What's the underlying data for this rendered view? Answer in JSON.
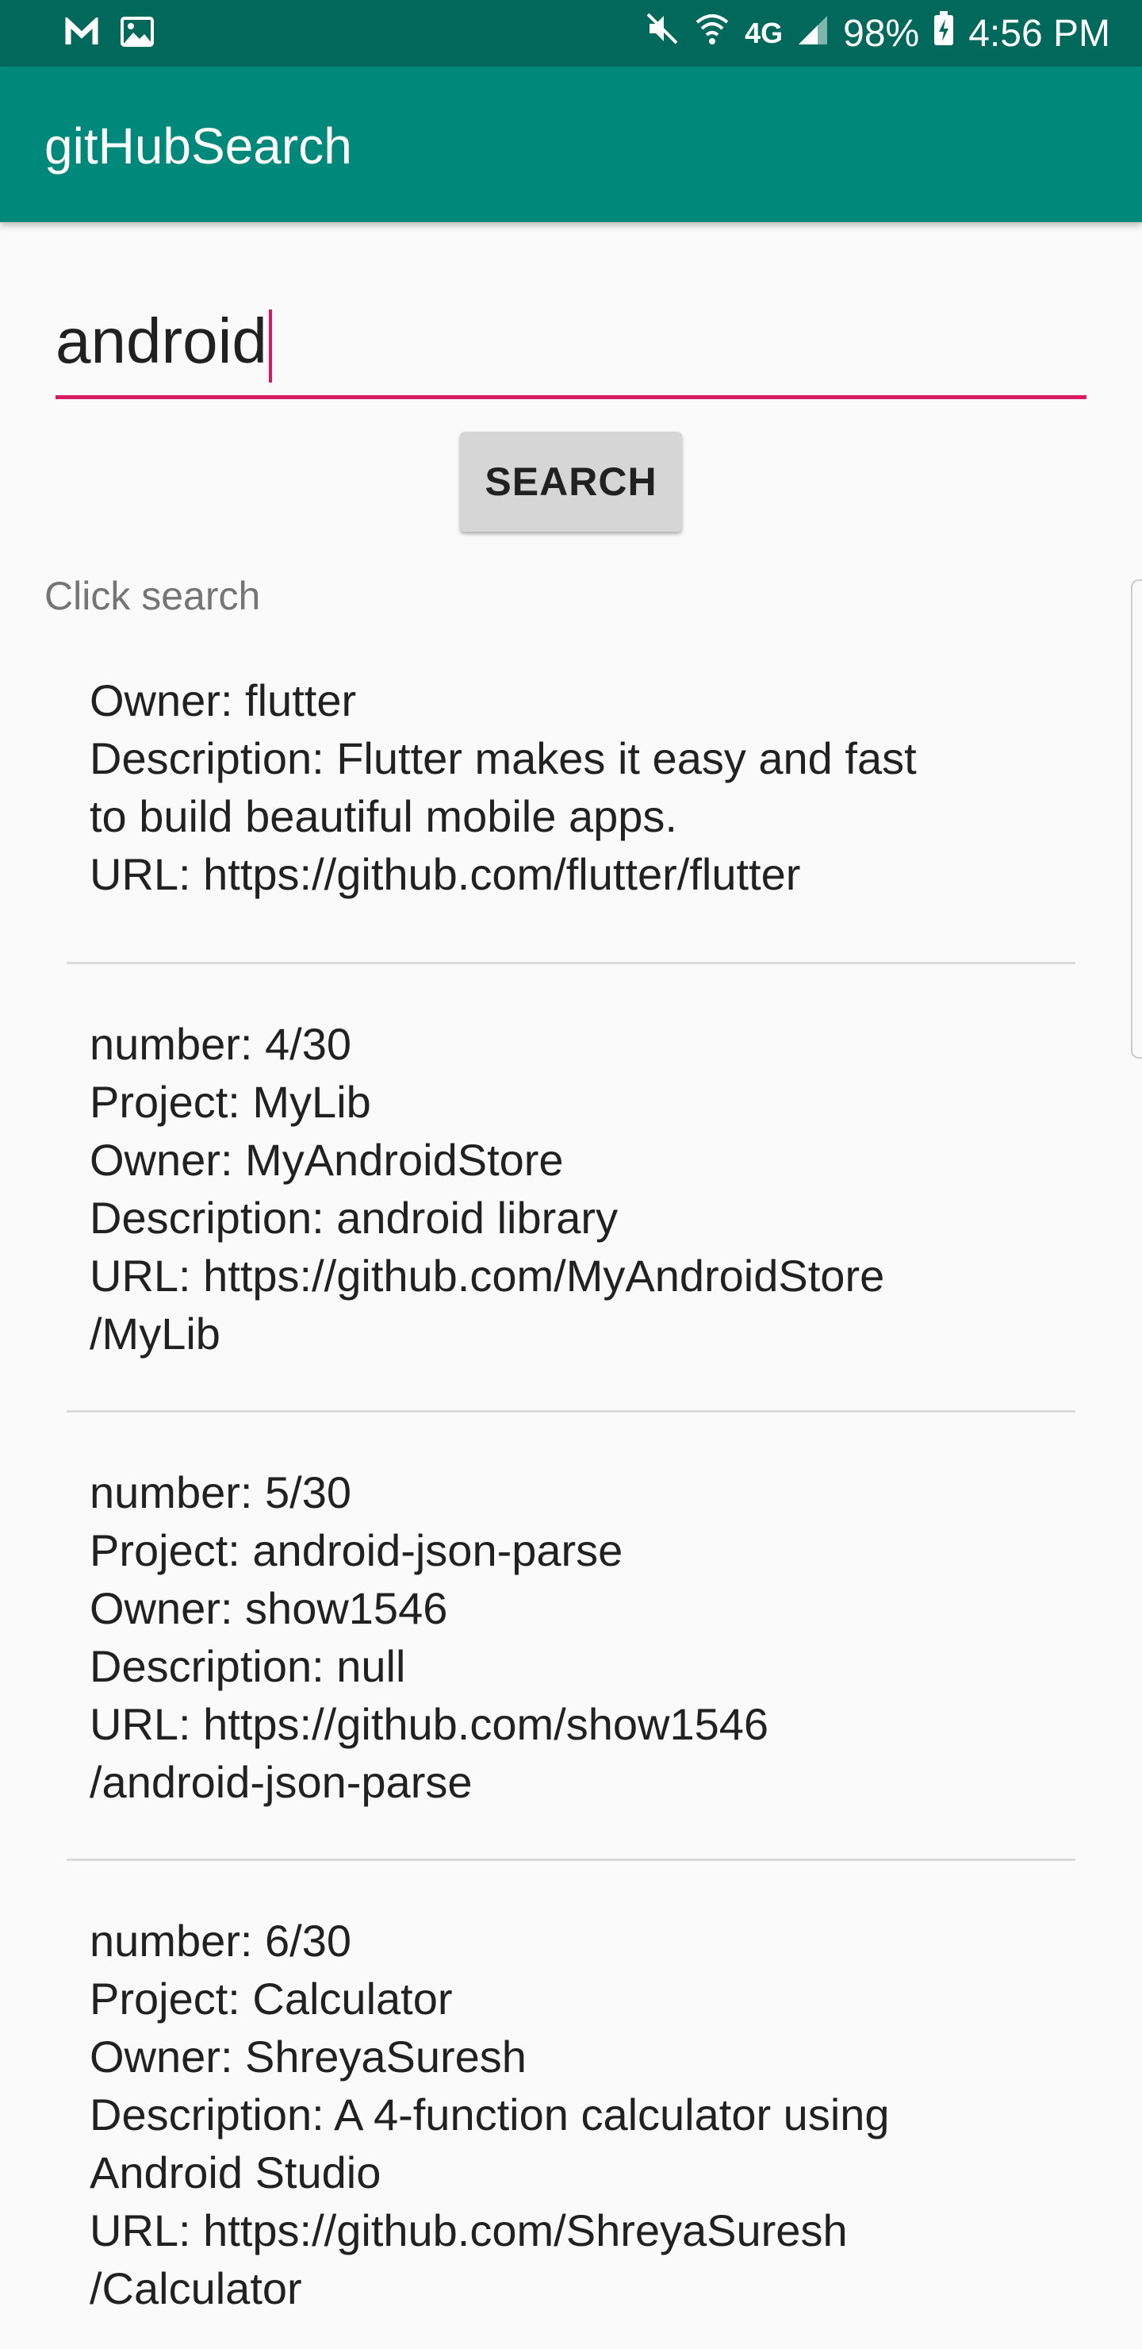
{
  "status_bar": {
    "battery": "98%",
    "time": "4:56 PM",
    "network": "4G",
    "icons": [
      "app-m-icon",
      "image-icon",
      "mute-icon",
      "wifi-icon",
      "signal-icon",
      "battery-charging-icon"
    ]
  },
  "app_bar": {
    "title": "gitHubSearch"
  },
  "search": {
    "value": "android",
    "button_label": "SEARCH"
  },
  "status_text": "Click search",
  "results": [
    {
      "number": "",
      "text": "Owner: flutter\nDescription: Flutter makes it easy and fast\nto build beautiful mobile apps.\nURL: https://github.com/flutter/flutter"
    },
    {
      "text": "number: 4/30\nProject: MyLib\nOwner: MyAndroidStore\nDescription: android library\nURL: https://github.com/MyAndroidStore\n/MyLib"
    },
    {
      "text": "number: 5/30\nProject: android-json-parse\nOwner: show1546\nDescription: null\nURL: https://github.com/show1546\n/android-json-parse"
    },
    {
      "text": "number: 6/30\nProject: Calculator\nOwner: ShreyaSuresh\nDescription: A 4-function calculator using\nAndroid Studio\nURL: https://github.com/ShreyaSuresh\n/Calculator"
    }
  ],
  "colors": {
    "status_bar": "#00695c",
    "app_bar": "#00897b",
    "accent": "#d81b60",
    "background": "#fafafa"
  }
}
